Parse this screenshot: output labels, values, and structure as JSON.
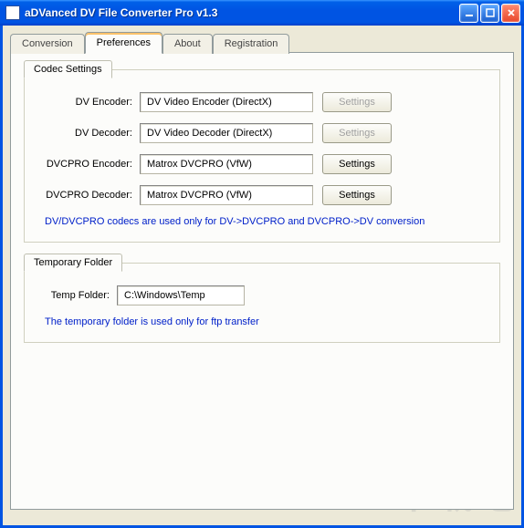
{
  "window": {
    "title": "aDVanced DV File Converter Pro v1.3"
  },
  "tabs": {
    "conversion": "Conversion",
    "preferences": "Preferences",
    "about": "About",
    "registration": "Registration"
  },
  "codec_group": {
    "legend": "Codec Settings",
    "rows": {
      "dv_encoder_label": "DV Encoder:",
      "dv_encoder_value": "DV Video Encoder (DirectX)",
      "dv_encoder_btn": "Settings",
      "dv_decoder_label": "DV Decoder:",
      "dv_decoder_value": "DV Video Decoder (DirectX)",
      "dv_decoder_btn": "Settings",
      "dvcpro_encoder_label": "DVCPRO Encoder:",
      "dvcpro_encoder_value": "Matrox DVCPRO (VfW)",
      "dvcpro_encoder_btn": "Settings",
      "dvcpro_decoder_label": "DVCPRO Decoder:",
      "dvcpro_decoder_value": "Matrox DVCPRO (VfW)",
      "dvcpro_decoder_btn": "Settings"
    },
    "note": "DV/DVCPRO codecs are used only for DV->DVCPRO and DVCPRO->DV conversion"
  },
  "temp_group": {
    "legend": "Temporary Folder",
    "label": "Temp Folder:",
    "value": "C:\\Windows\\Temp",
    "note": "The temporary folder is used only for ftp transfer"
  },
  "watermark": "下载吧"
}
